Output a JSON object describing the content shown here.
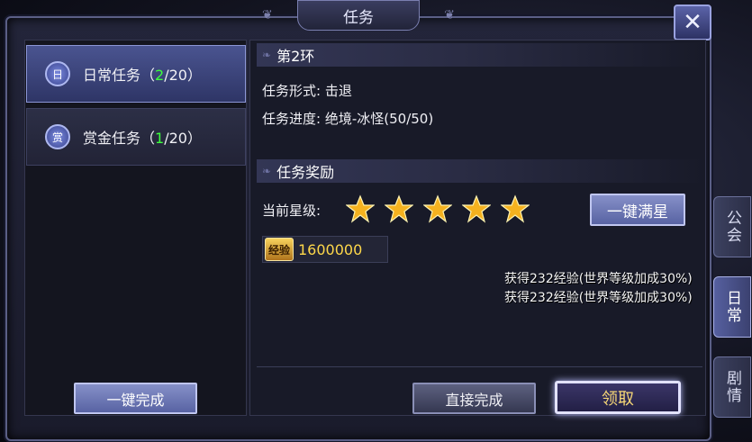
{
  "window": {
    "title": "任务",
    "close_label": "✕"
  },
  "tabs": [
    {
      "badge": "日",
      "label_prefix": "日常任务（",
      "done": "2",
      "label_suffix": "/20）"
    },
    {
      "badge": "赏",
      "label_prefix": "赏金任务（",
      "done": "1",
      "label_suffix": "/20）"
    }
  ],
  "quest": {
    "ring": "第2环",
    "type_label": "任务形式:",
    "type_value": "击退",
    "progress_label": "任务进度:",
    "progress_value": "绝境-冰怪(50/50)"
  },
  "rewards": {
    "header": "任务奖励",
    "star_label": "当前星级:",
    "stars": 5,
    "max_star_button": "一键满星",
    "exp_icon_text": "经验",
    "exp_value": "1600000"
  },
  "notifications": [
    "获得232经验(世界等级加成30%)",
    "获得232经验(世界等级加成30%)"
  ],
  "buttons": {
    "complete_all": "一键完成",
    "complete_direct": "直接完成",
    "claim": "领取"
  },
  "side_tabs": [
    {
      "label": "公会"
    },
    {
      "label": "日常"
    },
    {
      "label": "剧情"
    }
  ],
  "colors": {
    "accent_green": "#3cff3c",
    "exp_gold": "#ffd84a",
    "star_gold": "#f5b21f"
  }
}
